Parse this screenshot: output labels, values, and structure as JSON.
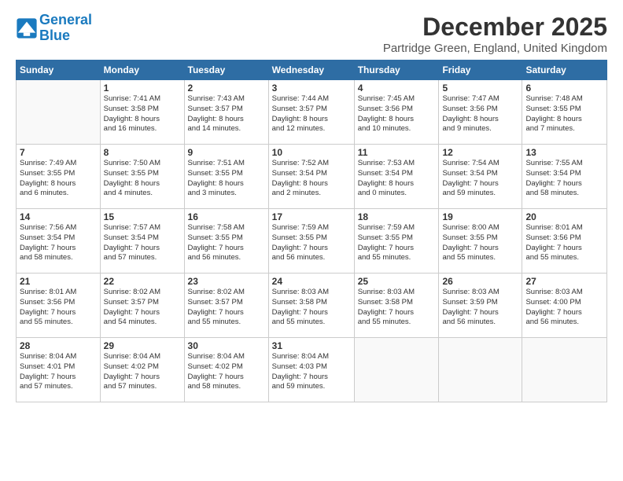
{
  "logo": {
    "line1": "General",
    "line2": "Blue"
  },
  "title": "December 2025",
  "subtitle": "Partridge Green, England, United Kingdom",
  "days_of_week": [
    "Sunday",
    "Monday",
    "Tuesday",
    "Wednesday",
    "Thursday",
    "Friday",
    "Saturday"
  ],
  "weeks": [
    [
      {
        "day": "",
        "info": ""
      },
      {
        "day": "1",
        "info": "Sunrise: 7:41 AM\nSunset: 3:58 PM\nDaylight: 8 hours\nand 16 minutes."
      },
      {
        "day": "2",
        "info": "Sunrise: 7:43 AM\nSunset: 3:57 PM\nDaylight: 8 hours\nand 14 minutes."
      },
      {
        "day": "3",
        "info": "Sunrise: 7:44 AM\nSunset: 3:57 PM\nDaylight: 8 hours\nand 12 minutes."
      },
      {
        "day": "4",
        "info": "Sunrise: 7:45 AM\nSunset: 3:56 PM\nDaylight: 8 hours\nand 10 minutes."
      },
      {
        "day": "5",
        "info": "Sunrise: 7:47 AM\nSunset: 3:56 PM\nDaylight: 8 hours\nand 9 minutes."
      },
      {
        "day": "6",
        "info": "Sunrise: 7:48 AM\nSunset: 3:55 PM\nDaylight: 8 hours\nand 7 minutes."
      }
    ],
    [
      {
        "day": "7",
        "info": "Sunrise: 7:49 AM\nSunset: 3:55 PM\nDaylight: 8 hours\nand 6 minutes."
      },
      {
        "day": "8",
        "info": "Sunrise: 7:50 AM\nSunset: 3:55 PM\nDaylight: 8 hours\nand 4 minutes."
      },
      {
        "day": "9",
        "info": "Sunrise: 7:51 AM\nSunset: 3:55 PM\nDaylight: 8 hours\nand 3 minutes."
      },
      {
        "day": "10",
        "info": "Sunrise: 7:52 AM\nSunset: 3:54 PM\nDaylight: 8 hours\nand 2 minutes."
      },
      {
        "day": "11",
        "info": "Sunrise: 7:53 AM\nSunset: 3:54 PM\nDaylight: 8 hours\nand 0 minutes."
      },
      {
        "day": "12",
        "info": "Sunrise: 7:54 AM\nSunset: 3:54 PM\nDaylight: 7 hours\nand 59 minutes."
      },
      {
        "day": "13",
        "info": "Sunrise: 7:55 AM\nSunset: 3:54 PM\nDaylight: 7 hours\nand 58 minutes."
      }
    ],
    [
      {
        "day": "14",
        "info": "Sunrise: 7:56 AM\nSunset: 3:54 PM\nDaylight: 7 hours\nand 58 minutes."
      },
      {
        "day": "15",
        "info": "Sunrise: 7:57 AM\nSunset: 3:54 PM\nDaylight: 7 hours\nand 57 minutes."
      },
      {
        "day": "16",
        "info": "Sunrise: 7:58 AM\nSunset: 3:55 PM\nDaylight: 7 hours\nand 56 minutes."
      },
      {
        "day": "17",
        "info": "Sunrise: 7:59 AM\nSunset: 3:55 PM\nDaylight: 7 hours\nand 56 minutes."
      },
      {
        "day": "18",
        "info": "Sunrise: 7:59 AM\nSunset: 3:55 PM\nDaylight: 7 hours\nand 55 minutes."
      },
      {
        "day": "19",
        "info": "Sunrise: 8:00 AM\nSunset: 3:55 PM\nDaylight: 7 hours\nand 55 minutes."
      },
      {
        "day": "20",
        "info": "Sunrise: 8:01 AM\nSunset: 3:56 PM\nDaylight: 7 hours\nand 55 minutes."
      }
    ],
    [
      {
        "day": "21",
        "info": "Sunrise: 8:01 AM\nSunset: 3:56 PM\nDaylight: 7 hours\nand 55 minutes."
      },
      {
        "day": "22",
        "info": "Sunrise: 8:02 AM\nSunset: 3:57 PM\nDaylight: 7 hours\nand 54 minutes."
      },
      {
        "day": "23",
        "info": "Sunrise: 8:02 AM\nSunset: 3:57 PM\nDaylight: 7 hours\nand 55 minutes."
      },
      {
        "day": "24",
        "info": "Sunrise: 8:03 AM\nSunset: 3:58 PM\nDaylight: 7 hours\nand 55 minutes."
      },
      {
        "day": "25",
        "info": "Sunrise: 8:03 AM\nSunset: 3:58 PM\nDaylight: 7 hours\nand 55 minutes."
      },
      {
        "day": "26",
        "info": "Sunrise: 8:03 AM\nSunset: 3:59 PM\nDaylight: 7 hours\nand 56 minutes."
      },
      {
        "day": "27",
        "info": "Sunrise: 8:03 AM\nSunset: 4:00 PM\nDaylight: 7 hours\nand 56 minutes."
      }
    ],
    [
      {
        "day": "28",
        "info": "Sunrise: 8:04 AM\nSunset: 4:01 PM\nDaylight: 7 hours\nand 57 minutes."
      },
      {
        "day": "29",
        "info": "Sunrise: 8:04 AM\nSunset: 4:02 PM\nDaylight: 7 hours\nand 57 minutes."
      },
      {
        "day": "30",
        "info": "Sunrise: 8:04 AM\nSunset: 4:02 PM\nDaylight: 7 hours\nand 58 minutes."
      },
      {
        "day": "31",
        "info": "Sunrise: 8:04 AM\nSunset: 4:03 PM\nDaylight: 7 hours\nand 59 minutes."
      },
      {
        "day": "",
        "info": ""
      },
      {
        "day": "",
        "info": ""
      },
      {
        "day": "",
        "info": ""
      }
    ]
  ]
}
